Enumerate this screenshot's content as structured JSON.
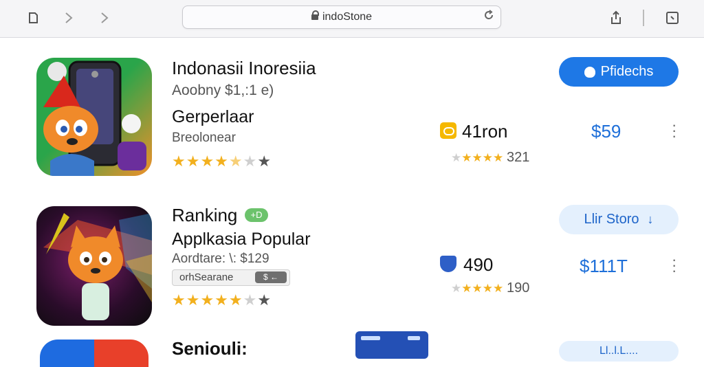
{
  "browser": {
    "url": "indoStone",
    "icons": {
      "tabs": "tabs-icon",
      "back": "chevron-left-icon",
      "forward": "chevron-right-icon",
      "reload": "reload-icon",
      "share": "share-icon",
      "bookmarks": "bookmarks-icon"
    }
  },
  "apps": [
    {
      "title": "Indonasii Inoresiia",
      "subtitle": "Aoobny $1,:1 e)",
      "name": "Gerperlaar",
      "category": "Breolonear",
      "rating": 3.5,
      "mid_value": "41ron",
      "mid_rating_count": "321",
      "price": "$59",
      "button_label": "Pfidechs"
    },
    {
      "title": "Ranking",
      "badge": "+D",
      "name": "Applkasia Popular",
      "subtitle": "Aordtare: \\: $129",
      "tag_label": "orhSearane",
      "tag_chip": "$ ←",
      "rating": 4.0,
      "mid_value": "490",
      "mid_rating_count": "190",
      "price": "$111T",
      "button_label": "Llir Storo"
    },
    {
      "title": "Seniouli:",
      "button_label": "Ll..l.L...."
    }
  ],
  "colors": {
    "primary_blue": "#1e78e6",
    "price_blue": "#1e6fd9",
    "star_gold": "#f2b01e",
    "light_blue_bg": "#e4f0fd"
  }
}
